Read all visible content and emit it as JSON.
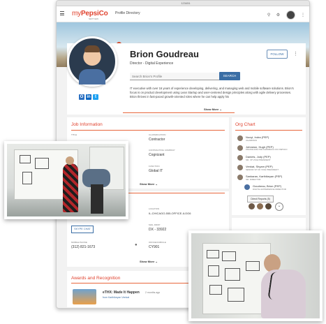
{
  "browser": {
    "url": "123451"
  },
  "app": {
    "logo_prefix": "my",
    "logo_brand": "PepsiCo",
    "logo_sub": "NEXT GEN",
    "breadcrumb": "Profile Directory"
  },
  "profile": {
    "name": "Brion Goudreau",
    "title": "Director - Digital Experience",
    "follow_label": "FOLLOW",
    "search_placeholder": "Search Brion's Profile",
    "search_label": "SEARCH",
    "bio": "IT executive with over 16 years of experience developing, delivering, and managing web and mobile software solutions. Brion's focus is on product development using Lean Startup and user-centered design principles along with agile delivery processes. Brion thrives in fast-paced growth-oriented roles where he can help apply his",
    "show_more": "Show More"
  },
  "job_info": {
    "heading": "Job Information",
    "fields": [
      {
        "label": "TITLE",
        "value": ""
      },
      {
        "label": "CLASSIFICATION",
        "value": "Contractor"
      },
      {
        "label": "CONTRACTING COMPANY",
        "value": "Cognizant"
      },
      {
        "label": "FUNCTION",
        "value": "Global IT"
      }
    ],
    "show_more": "Show More"
  },
  "contact": {
    "skype_label": "SKYPE CHAT",
    "location_label": "LOCATION",
    "location_value": "IL-CHICAGO-555-OFFICE-ILOG6",
    "mail_drop_label": "MAIL DROP",
    "mail_drop_value": "DX - 33922",
    "home_phone_label": "MOBILE PHONE",
    "home_phone_value": "(312) 821-1673",
    "office_label": "OFFICE/CUBICLE",
    "office_value": "CY901",
    "show_more": "Show More"
  },
  "awards": {
    "heading": "Awards and Recognition",
    "items": [
      {
        "title": "eTHX: Made It Happen",
        "when": "2 months ago",
        "from": "from Karthikeyan Venkat"
      }
    ]
  },
  "org_chart": {
    "heading": "Org Chart",
    "people": [
      {
        "name": "Nooyi, Indra (PEP)",
        "role": "CHAIRMAN"
      },
      {
        "name": "Johnston, Hugh (PEP)",
        "role": "FINANCE EXE VICE CHAIRMAN & CFO PEPSICO"
      },
      {
        "name": "Daniels, Jody (PEP)",
        "role": "SR. VP VICE PRESIDENT"
      },
      {
        "name": "Venkat, Shyam (PEP)",
        "role": "SENIOR VP OF VICE PRESIDENT"
      },
      {
        "name": "Sankaran, Karthikeyan (PEP)",
        "role": "SR. DIRECTOR"
      },
      {
        "name": "Goudreau, Brion (PEP)",
        "role": "DIGITAL EXPERIENCE DIRECTOR"
      }
    ],
    "direct_reports": "Direct Reports (5)"
  },
  "colors": {
    "accent": "#e0422e",
    "primary": "#3a6ea5",
    "divider": "#e8663b"
  },
  "icons": [
    "hamburger-icon",
    "search-icon",
    "settings-icon",
    "kebab-icon",
    "map-pin-icon",
    "chevron-down-icon",
    "outlook-icon",
    "linkedin-icon",
    "twitter-icon"
  ]
}
